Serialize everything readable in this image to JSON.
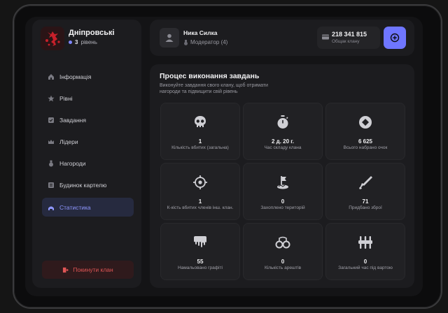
{
  "clan": {
    "name": "Дніпровські",
    "level_number": "3",
    "level_word": "рівень"
  },
  "nav": [
    {
      "label": "Інформація",
      "icon": "house-icon"
    },
    {
      "label": "Рівні",
      "icon": "star-icon"
    },
    {
      "label": "Завдання",
      "icon": "checklist-icon"
    },
    {
      "label": "Лідери",
      "icon": "crown-icon"
    },
    {
      "label": "Нагороди",
      "icon": "medal-icon"
    },
    {
      "label": "Будинок картелю",
      "icon": "building-icon"
    },
    {
      "label": "Статистика",
      "icon": "chart-icon",
      "active": true
    }
  ],
  "leave_label": "Покинути клан",
  "user": {
    "name": "Ника Силка",
    "role": "Модератор (4)"
  },
  "balance": {
    "value": "218 341 815",
    "label": "Общак клану"
  },
  "main": {
    "title": "Процес виконання завдань",
    "description": "Виконуйте завдання свого клану, щоб отримати нагороди та підвищити свій рівень"
  },
  "stats": [
    {
      "value": "1",
      "label": "Кількість вбитих (загальна)",
      "icon": "skull-icon"
    },
    {
      "value": "2 д. 20 г.",
      "label": "Час складу клана",
      "icon": "stopwatch-icon"
    },
    {
      "value": "6 625",
      "label": "Всього набрано очок",
      "icon": "diamond-icon"
    },
    {
      "value": "1",
      "label": "К-кість вбитих членів інш. клан.",
      "icon": "crosshair-icon"
    },
    {
      "value": "0",
      "label": "Захоплено територій",
      "icon": "flag-icon"
    },
    {
      "value": "71",
      "label": "Придбано зброї",
      "icon": "rifle-icon"
    },
    {
      "value": "55",
      "label": "Намальовано графіті",
      "icon": "paint-icon"
    },
    {
      "value": "0",
      "label": "Кількість арештів",
      "icon": "handcuffs-icon"
    },
    {
      "value": "0",
      "label": "Загальний час під вартою",
      "icon": "prison-icon"
    }
  ],
  "colors": {
    "accent": "#6f76ff",
    "danger": "#e05555",
    "panel": "#1c1c1f"
  }
}
